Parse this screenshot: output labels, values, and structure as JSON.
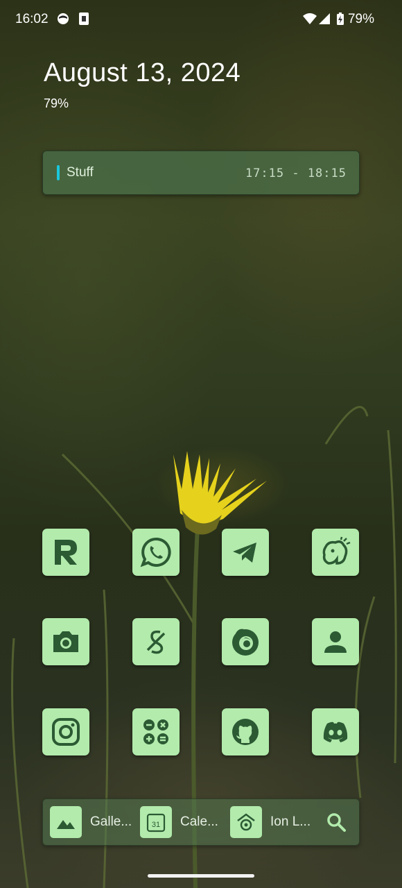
{
  "status_bar": {
    "time": "16:02",
    "battery_percent": "79%",
    "icons": [
      "face-notification-icon",
      "sim-notification-icon",
      "wifi-icon",
      "cell-signal-icon",
      "battery-charging-icon"
    ]
  },
  "clock_widget": {
    "date": "August 13, 2024",
    "battery": "79%"
  },
  "calendar_event": {
    "title": "Stuff",
    "time_range": "17:15  -  18:15",
    "accent_color": "#19c7dc"
  },
  "apps": [
    {
      "name": "Revolut",
      "icon": "revolut-r-icon"
    },
    {
      "name": "WhatsApp",
      "icon": "whatsapp-icon"
    },
    {
      "name": "Telegram",
      "icon": "telegram-icon"
    },
    {
      "name": "Mastodon",
      "icon": "elephant-icon"
    },
    {
      "name": "Camera",
      "icon": "camera-icon"
    },
    {
      "name": "Splitwise",
      "icon": "split-icon"
    },
    {
      "name": "Firefox",
      "icon": "firefox-icon"
    },
    {
      "name": "Contacts",
      "icon": "contact-icon"
    },
    {
      "name": "Instagram",
      "icon": "instagram-icon"
    },
    {
      "name": "Calculator",
      "icon": "calculator-icon"
    },
    {
      "name": "GitHub",
      "icon": "github-icon"
    },
    {
      "name": "Discord",
      "icon": "discord-icon"
    }
  ],
  "dock": {
    "items": [
      {
        "label": "Galle...",
        "icon": "gallery-mountain-icon"
      },
      {
        "label": "Cale...",
        "icon": "calendar-31-icon",
        "day": "31"
      },
      {
        "label": "Ion L...",
        "icon": "ion-launcher-icon"
      }
    ],
    "search_icon": "search-icon"
  },
  "theme": {
    "icon_bg": "#b2ebac",
    "icon_fg": "#2b5a33"
  }
}
